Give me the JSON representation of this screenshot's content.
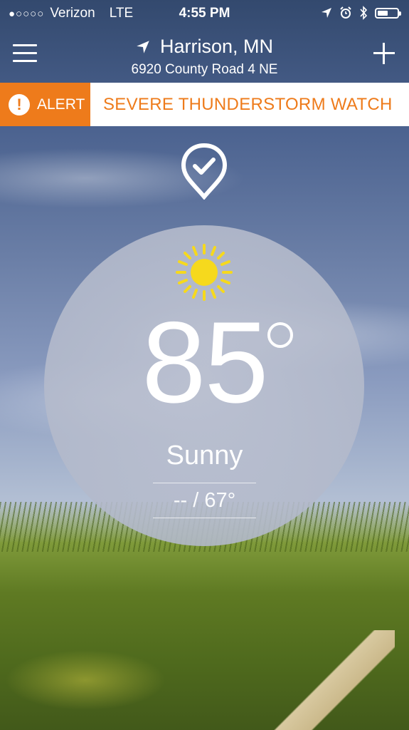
{
  "status_bar": {
    "signal_dots": "●○○○○",
    "carrier": "Verizon",
    "network": "LTE",
    "time": "4:55 PM",
    "icons": [
      "location-arrow-icon",
      "alarm-icon",
      "bluetooth-icon",
      "battery-icon"
    ],
    "battery_level_percent": 45
  },
  "header": {
    "city": "Harrison, MN",
    "address": "6920 County Road 4 NE",
    "left_icon": "menu-icon",
    "right_icon": "plus-icon",
    "location_icon": "location-arrow-icon"
  },
  "alert": {
    "label": "ALERT",
    "message": "SEVERE THUNDERSTORM WATCH",
    "accent_color": "#ee7b1b"
  },
  "current": {
    "pin_icon": "checkmark-pin-icon",
    "condition_icon": "sun-icon",
    "temperature": "85",
    "condition": "Sunny",
    "hi_lo": "-- / 67°"
  }
}
